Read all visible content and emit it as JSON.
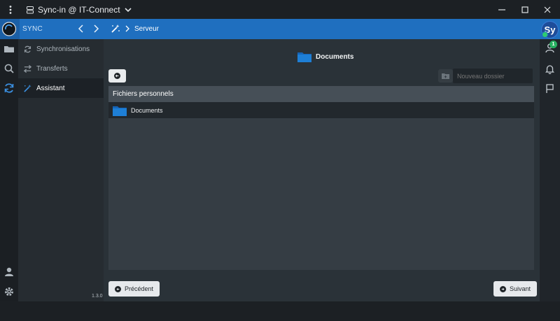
{
  "titlebar": {
    "profile_name": "Sync-in @ IT-Connect"
  },
  "header": {
    "section_label": "SYNC",
    "breadcrumb": "Serveur",
    "avatar_initials": "Sy"
  },
  "sidebar": {
    "items": [
      {
        "label": "Synchronisations",
        "icon": "sync-icon"
      },
      {
        "label": "Transferts",
        "icon": "transfer-icon"
      },
      {
        "label": "Assistant",
        "icon": "magic-wand-icon",
        "active": true
      }
    ],
    "version": "1.3.0"
  },
  "main": {
    "current_folder": "Documents",
    "new_folder_placeholder": "Nouveau dossier",
    "panel_title": "Fichiers personnels",
    "files": [
      {
        "name": "Documents",
        "type": "folder"
      }
    ],
    "prev_button": "Précédent",
    "next_button": "Suivant"
  },
  "rightrail": {
    "notification_count": "1"
  },
  "colors": {
    "accent": "#1f6fbf",
    "folder": "#1e7fd6",
    "badge": "#27ae60"
  }
}
